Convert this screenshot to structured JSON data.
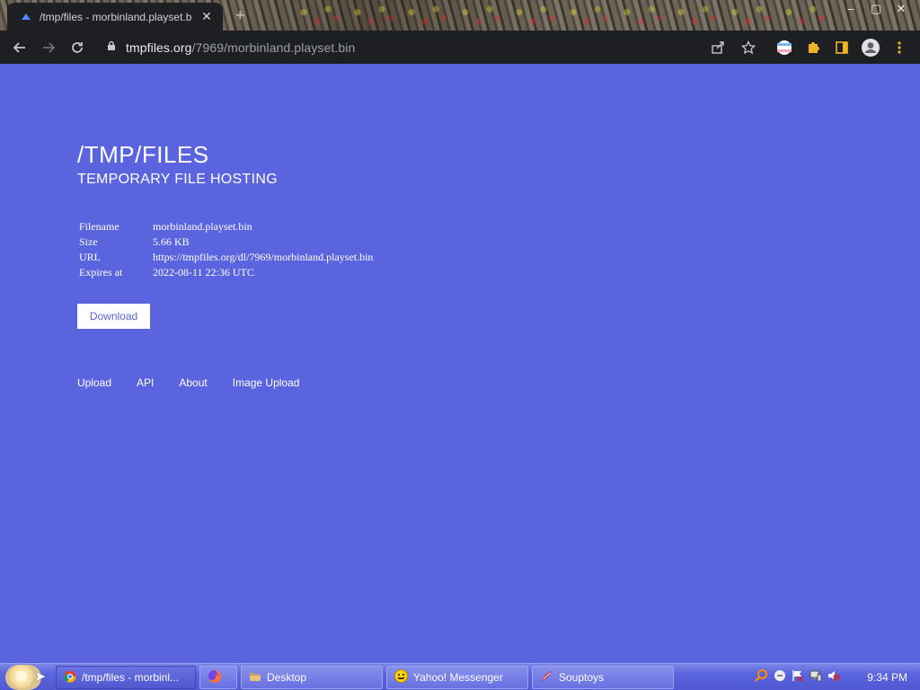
{
  "browser": {
    "tab_title": "/tmp/files - morbinland.playset.bi",
    "url_host": "tmpfiles.org",
    "url_path": "/7969/morbinland.playset.bin"
  },
  "page": {
    "title": "/TMP/FILES",
    "subtitle": "TEMPORARY FILE HOSTING",
    "file_info": [
      {
        "key": "Filename",
        "value": "morbinland.playset.bin"
      },
      {
        "key": "Size",
        "value": "5.66 KB"
      },
      {
        "key": "URL",
        "value": "https://tmpfiles.org/dl/7969/morbinland.playset.bin"
      },
      {
        "key": "Expires at",
        "value": "2022-08-11 22:36 UTC"
      }
    ],
    "download_label": "Download",
    "footer_links": [
      "Upload",
      "API",
      "About",
      "Image Upload"
    ]
  },
  "taskbar": {
    "items": [
      {
        "label": "/tmp/files - morbinl...",
        "icon": "chrome-icon",
        "active": true
      },
      {
        "label": "",
        "icon": "firefox-icon",
        "active": false
      },
      {
        "label": "Desktop",
        "icon": "folder-icon",
        "active": false
      },
      {
        "label": "Yahoo! Messenger",
        "icon": "yahoo-smiley-icon",
        "active": false
      },
      {
        "label": "Souptoys",
        "icon": "souptoys-icon",
        "active": false
      }
    ],
    "clock": "9:34 PM"
  },
  "colors": {
    "page_background": "#5a64df",
    "chrome_dark": "#1e1f22"
  }
}
